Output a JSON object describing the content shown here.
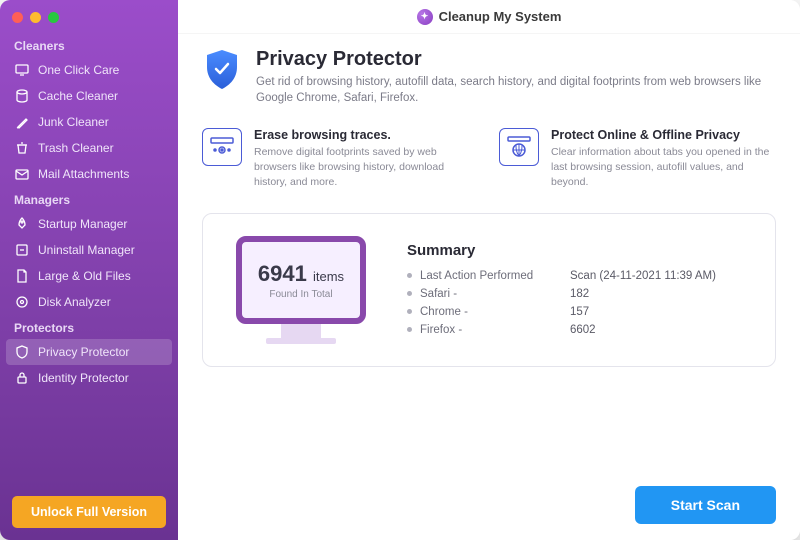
{
  "app_title": "Cleanup My System",
  "colors": {
    "accent": "#8949ab",
    "primary_btn": "#2196f3",
    "unlock_btn": "#f5a623"
  },
  "sidebar": {
    "sections": [
      {
        "title": "Cleaners",
        "items": [
          {
            "label": "One Click Care",
            "icon": "monitor-icon"
          },
          {
            "label": "Cache Cleaner",
            "icon": "cache-icon"
          },
          {
            "label": "Junk Cleaner",
            "icon": "brush-icon"
          },
          {
            "label": "Trash Cleaner",
            "icon": "trash-icon"
          },
          {
            "label": "Mail Attachments",
            "icon": "mail-icon"
          }
        ]
      },
      {
        "title": "Managers",
        "items": [
          {
            "label": "Startup Manager",
            "icon": "rocket-icon"
          },
          {
            "label": "Uninstall Manager",
            "icon": "uninstall-icon"
          },
          {
            "label": "Large & Old Files",
            "icon": "bigfile-icon"
          },
          {
            "label": "Disk Analyzer",
            "icon": "disk-icon"
          }
        ]
      },
      {
        "title": "Protectors",
        "items": [
          {
            "label": "Privacy Protector",
            "icon": "shield-icon",
            "active": true
          },
          {
            "label": "Identity Protector",
            "icon": "lock-icon"
          }
        ]
      }
    ],
    "unlock_label": "Unlock Full Version"
  },
  "page": {
    "title": "Privacy Protector",
    "subtitle": "Get rid of browsing history, autofill data, search history, and digital footprints from web browsers like Google Chrome, Safari, Firefox.",
    "features": [
      {
        "title": "Erase browsing traces.",
        "desc": "Remove digital footprints saved by web browsers like browsing history, download history, and more.",
        "icon": "eye-icon"
      },
      {
        "title": "Protect Online & Offline Privacy",
        "desc": "Clear information about tabs you opened in the last browsing session, autofill values, and beyond.",
        "icon": "globe-icon"
      }
    ],
    "summary": {
      "heading": "Summary",
      "count": "6941",
      "count_unit": "items",
      "count_sub": "Found In Total",
      "rows": [
        {
          "label": "Last Action Performed",
          "value": "Scan (24-11-2021 11:39 AM)"
        },
        {
          "label": "Safari -",
          "value": "182"
        },
        {
          "label": "Chrome -",
          "value": "157"
        },
        {
          "label": "Firefox -",
          "value": "6602"
        }
      ]
    },
    "start_button": "Start Scan"
  }
}
